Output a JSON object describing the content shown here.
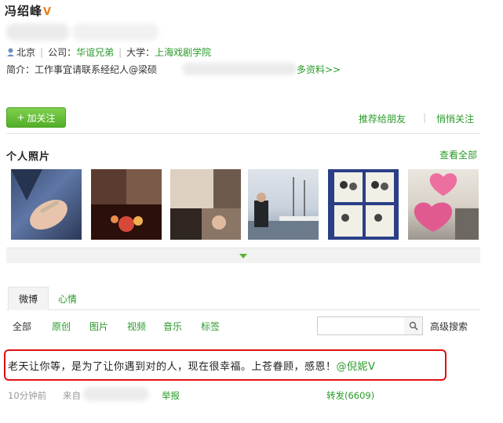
{
  "profile": {
    "name": "冯绍峰",
    "verified_mark": "V",
    "location": "北京",
    "company_label": "公司：",
    "company": "华谊兄弟",
    "university_label": "大学：",
    "university": "上海戏剧学院",
    "intro_label": "简介：",
    "intro": "工作事宜请联系经纪人@梁硕",
    "more_info": "多资料>>"
  },
  "actions": {
    "follow": "加关注",
    "follow_plus": "+",
    "recommend": "推荐给朋友",
    "unfollow": "悄悄关注"
  },
  "photos": {
    "title": "个人照片",
    "view_all": "查看全部"
  },
  "tabs": [
    "微博",
    "心情"
  ],
  "filters": [
    "全部",
    "原创",
    "图片",
    "视频",
    "音乐",
    "标签"
  ],
  "search": {
    "placeholder": "",
    "advanced": "高级搜索"
  },
  "post": {
    "text": "老天让你等，是为了让你遇到对的人，现在很幸福。上苍眷顾，感恩！",
    "mention": "@倪妮",
    "mention_v": "V",
    "time": "10分钟前",
    "source_label": "来自",
    "report": "举报",
    "repost": "转发(6609)"
  },
  "colors": {
    "link": "#2a9a2a",
    "highlight": "#e01010",
    "verified": "#e87d14"
  }
}
